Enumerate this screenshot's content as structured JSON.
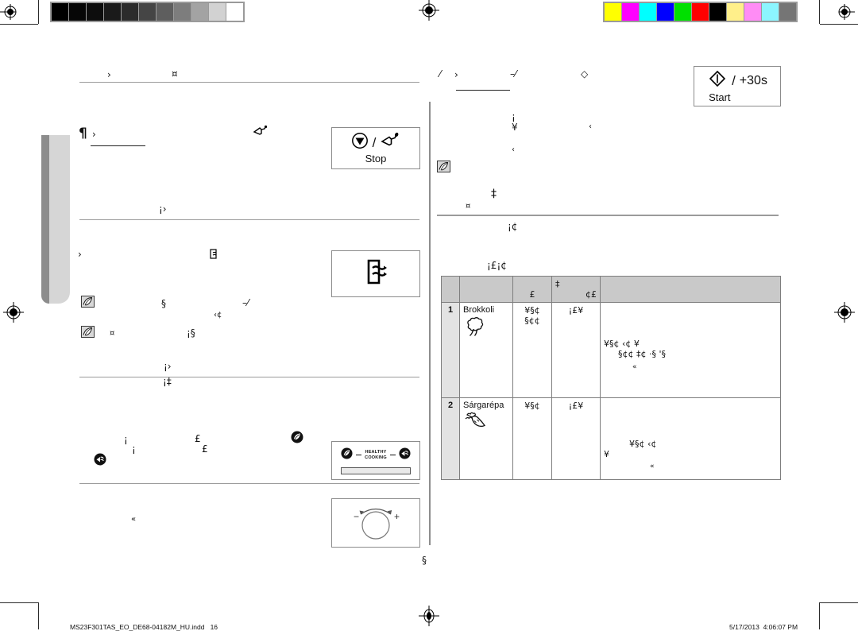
{
  "document": {
    "kind": "prepress-proof-page",
    "footer": {
      "filename": "MS23F301TAS_EO_DE68-04182M_HU.indd",
      "page_number": "16",
      "date": "5/17/2013",
      "time": "4:06:07 PM"
    }
  },
  "calibration": {
    "gray_bar": {
      "name": "grayscale-calibration-bar",
      "swatches": [
        "#000000",
        "#060606",
        "#0d0d0d",
        "#1a1a1a",
        "#2b2b2b",
        "#454545",
        "#5e5e5e",
        "#7d7d7d",
        "#a3a3a3",
        "#d2d2d2",
        "#ffffff"
      ]
    },
    "color_bar": {
      "name": "color-calibration-bar",
      "swatches": [
        "#ffff00",
        "#ff00ff",
        "#00ffff",
        "#0000ff",
        "#00e000",
        "#ff0000",
        "#000000",
        "#ffef8a",
        "#ff8cf5",
        "#8cf5ff",
        "#757575"
      ]
    }
  },
  "left_column": {
    "heading_rule_1": {
      "glyphs_a": "›",
      "glyphs_b": "¤"
    },
    "para_1": {
      "bullet": "¶",
      "glyph": "›",
      "inline_icon": "door-open-icon"
    },
    "heading_rule_2": {
      "glyphs": "¡›"
    },
    "para_2": {
      "glyph": "›",
      "inline_icon": "deodorize-icon"
    },
    "note_1": {
      "icon": "note-leaf-icon",
      "glyphs_a": "§",
      "glyphs_b": "–⁄",
      "glyphs_c": "‹¢"
    },
    "note_2": {
      "icon": "note-leaf-icon",
      "glyphs_a": "¤",
      "glyphs_b": "¡§"
    },
    "heading_rule_3": {
      "glyphs_a": "¡›",
      "glyphs_b": "¡‡"
    },
    "para_3": {
      "g1": "¡",
      "g2": "£",
      "g3": "¡",
      "g4": "£",
      "icon_a": "healthy-cooking-badge-icon",
      "icon_b": "steam-cooking-badge-icon"
    },
    "para_4": {
      "glyph": "«"
    },
    "foot_glyph": "§"
  },
  "right_column": {
    "heading_rule_1": {
      "g1": "⁄",
      "g2": "›",
      "g3": "–⁄",
      "g4": "◇"
    },
    "body_1": {
      "g1": "¡",
      "g2": "¥",
      "g3": "‹",
      "g4": "‹"
    },
    "note_1": {
      "icon": "note-leaf-icon",
      "glyphs_a": "‡",
      "glyphs_b": "¤"
    },
    "subhead": {
      "glyphs": "¡¢"
    },
    "table_caption": {
      "glyphs": "¡£¡¢"
    }
  },
  "key_boxes": [
    {
      "name": "stop-eco-key",
      "symbol": "stop-triangle-icon",
      "separator": "/",
      "secondary_symbol": "eco-plug-icon",
      "label": "Stop"
    },
    {
      "name": "deodorize-key",
      "symbol": "deodorize-icon",
      "separator": "",
      "secondary_symbol": "",
      "label": ""
    },
    {
      "name": "healthy-cooking-key",
      "symbol": "healthy-cooking-badge-icon",
      "separator": "",
      "secondary_symbol": "steam-cooking-badge-icon",
      "label_line1": "HEALTHY",
      "label_line2": "COOKING"
    },
    {
      "name": "dial-key",
      "symbol": "rotary-dial-icon",
      "minus": "−",
      "plus": "+"
    },
    {
      "name": "start-plus30s-key",
      "symbol": "start-diamond-icon",
      "separator": "/",
      "secondary_label": "+30s",
      "label": "Start"
    }
  ],
  "table": {
    "caption_glyphs": "¡£¡¢",
    "headers": [
      "",
      "",
      "£",
      "‡\n¢£",
      ""
    ],
    "header_col3_glyph": "£",
    "header_col4_glyph_top": "‡",
    "header_col4_glyph_bottom": "¢£",
    "rows": [
      {
        "index": "1",
        "food": "Brokkoli",
        "food_icon": "broccoli-icon",
        "amount_line1": "¥§¢",
        "amount_line2": "§¢¢",
        "power": "¡£¥",
        "instructions_line1": "¥§¢        ‹¢    ¥",
        "instructions_line2": "§¢¢          ‡¢ ·§      '§",
        "instructions_line3": "«"
      },
      {
        "index": "2",
        "food": "Sárgarépa",
        "food_icon": "carrot-icon",
        "amount_line1": "¥§¢",
        "amount_line2": "",
        "power": "¡£¥",
        "instructions_line1": "¥§¢             ‹¢",
        "instructions_line2": "¥",
        "instructions_line3": "«"
      }
    ]
  }
}
